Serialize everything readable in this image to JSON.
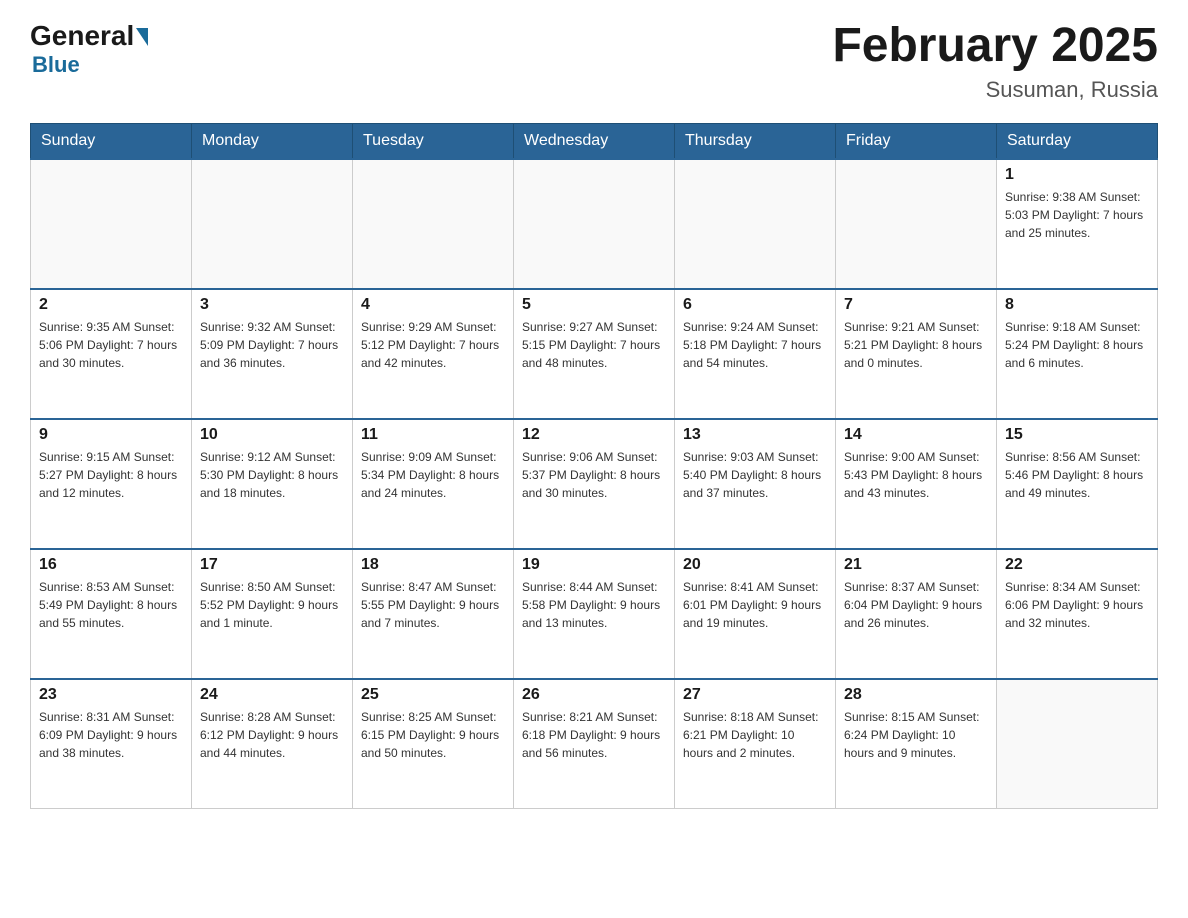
{
  "header": {
    "logo_general": "General",
    "logo_blue": "Blue",
    "month_title": "February 2025",
    "location": "Susuman, Russia"
  },
  "weekdays": [
    "Sunday",
    "Monday",
    "Tuesday",
    "Wednesday",
    "Thursday",
    "Friday",
    "Saturday"
  ],
  "weeks": [
    [
      {
        "day": "",
        "info": ""
      },
      {
        "day": "",
        "info": ""
      },
      {
        "day": "",
        "info": ""
      },
      {
        "day": "",
        "info": ""
      },
      {
        "day": "",
        "info": ""
      },
      {
        "day": "",
        "info": ""
      },
      {
        "day": "1",
        "info": "Sunrise: 9:38 AM\nSunset: 5:03 PM\nDaylight: 7 hours\nand 25 minutes."
      }
    ],
    [
      {
        "day": "2",
        "info": "Sunrise: 9:35 AM\nSunset: 5:06 PM\nDaylight: 7 hours\nand 30 minutes."
      },
      {
        "day": "3",
        "info": "Sunrise: 9:32 AM\nSunset: 5:09 PM\nDaylight: 7 hours\nand 36 minutes."
      },
      {
        "day": "4",
        "info": "Sunrise: 9:29 AM\nSunset: 5:12 PM\nDaylight: 7 hours\nand 42 minutes."
      },
      {
        "day": "5",
        "info": "Sunrise: 9:27 AM\nSunset: 5:15 PM\nDaylight: 7 hours\nand 48 minutes."
      },
      {
        "day": "6",
        "info": "Sunrise: 9:24 AM\nSunset: 5:18 PM\nDaylight: 7 hours\nand 54 minutes."
      },
      {
        "day": "7",
        "info": "Sunrise: 9:21 AM\nSunset: 5:21 PM\nDaylight: 8 hours\nand 0 minutes."
      },
      {
        "day": "8",
        "info": "Sunrise: 9:18 AM\nSunset: 5:24 PM\nDaylight: 8 hours\nand 6 minutes."
      }
    ],
    [
      {
        "day": "9",
        "info": "Sunrise: 9:15 AM\nSunset: 5:27 PM\nDaylight: 8 hours\nand 12 minutes."
      },
      {
        "day": "10",
        "info": "Sunrise: 9:12 AM\nSunset: 5:30 PM\nDaylight: 8 hours\nand 18 minutes."
      },
      {
        "day": "11",
        "info": "Sunrise: 9:09 AM\nSunset: 5:34 PM\nDaylight: 8 hours\nand 24 minutes."
      },
      {
        "day": "12",
        "info": "Sunrise: 9:06 AM\nSunset: 5:37 PM\nDaylight: 8 hours\nand 30 minutes."
      },
      {
        "day": "13",
        "info": "Sunrise: 9:03 AM\nSunset: 5:40 PM\nDaylight: 8 hours\nand 37 minutes."
      },
      {
        "day": "14",
        "info": "Sunrise: 9:00 AM\nSunset: 5:43 PM\nDaylight: 8 hours\nand 43 minutes."
      },
      {
        "day": "15",
        "info": "Sunrise: 8:56 AM\nSunset: 5:46 PM\nDaylight: 8 hours\nand 49 minutes."
      }
    ],
    [
      {
        "day": "16",
        "info": "Sunrise: 8:53 AM\nSunset: 5:49 PM\nDaylight: 8 hours\nand 55 minutes."
      },
      {
        "day": "17",
        "info": "Sunrise: 8:50 AM\nSunset: 5:52 PM\nDaylight: 9 hours\nand 1 minute."
      },
      {
        "day": "18",
        "info": "Sunrise: 8:47 AM\nSunset: 5:55 PM\nDaylight: 9 hours\nand 7 minutes."
      },
      {
        "day": "19",
        "info": "Sunrise: 8:44 AM\nSunset: 5:58 PM\nDaylight: 9 hours\nand 13 minutes."
      },
      {
        "day": "20",
        "info": "Sunrise: 8:41 AM\nSunset: 6:01 PM\nDaylight: 9 hours\nand 19 minutes."
      },
      {
        "day": "21",
        "info": "Sunrise: 8:37 AM\nSunset: 6:04 PM\nDaylight: 9 hours\nand 26 minutes."
      },
      {
        "day": "22",
        "info": "Sunrise: 8:34 AM\nSunset: 6:06 PM\nDaylight: 9 hours\nand 32 minutes."
      }
    ],
    [
      {
        "day": "23",
        "info": "Sunrise: 8:31 AM\nSunset: 6:09 PM\nDaylight: 9 hours\nand 38 minutes."
      },
      {
        "day": "24",
        "info": "Sunrise: 8:28 AM\nSunset: 6:12 PM\nDaylight: 9 hours\nand 44 minutes."
      },
      {
        "day": "25",
        "info": "Sunrise: 8:25 AM\nSunset: 6:15 PM\nDaylight: 9 hours\nand 50 minutes."
      },
      {
        "day": "26",
        "info": "Sunrise: 8:21 AM\nSunset: 6:18 PM\nDaylight: 9 hours\nand 56 minutes."
      },
      {
        "day": "27",
        "info": "Sunrise: 8:18 AM\nSunset: 6:21 PM\nDaylight: 10 hours\nand 2 minutes."
      },
      {
        "day": "28",
        "info": "Sunrise: 8:15 AM\nSunset: 6:24 PM\nDaylight: 10 hours\nand 9 minutes."
      },
      {
        "day": "",
        "info": ""
      }
    ]
  ]
}
